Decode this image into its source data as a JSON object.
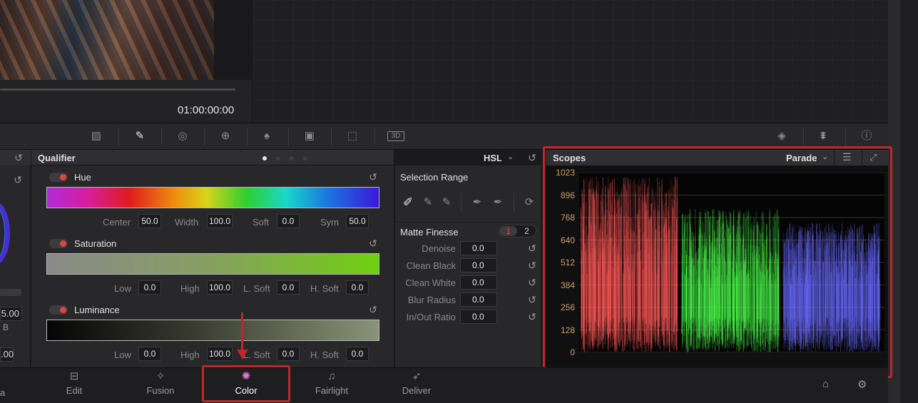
{
  "viewer": {
    "timecode": "01:00:00:00"
  },
  "left_stub": {
    "value1": "5.00",
    "channel": "B",
    "value2": ".00"
  },
  "qualifier": {
    "title": "Qualifier",
    "mode": "HSL",
    "hue": {
      "label": "Hue",
      "fields": [
        {
          "label": "Center",
          "value": "50.0"
        },
        {
          "label": "Width",
          "value": "100.0"
        },
        {
          "label": "Soft",
          "value": "0.0"
        },
        {
          "label": "Sym",
          "value": "50.0"
        }
      ]
    },
    "saturation": {
      "label": "Saturation",
      "fields": [
        {
          "label": "Low",
          "value": "0.0"
        },
        {
          "label": "High",
          "value": "100.0"
        },
        {
          "label": "L. Soft",
          "value": "0.0"
        },
        {
          "label": "H. Soft",
          "value": "0.0"
        }
      ]
    },
    "luminance": {
      "label": "Luminance",
      "fields": [
        {
          "label": "Low",
          "value": "0.0"
        },
        {
          "label": "High",
          "value": "100.0"
        },
        {
          "label": "L. Soft",
          "value": "0.0"
        },
        {
          "label": "H. Soft",
          "value": "0.0"
        }
      ]
    }
  },
  "selection_range": {
    "title": "Selection Range"
  },
  "matte_finesse": {
    "title": "Matte Finesse",
    "tabs": [
      "1",
      "2"
    ],
    "rows": [
      {
        "label": "Denoise",
        "value": "0.0"
      },
      {
        "label": "Clean Black",
        "value": "0.0"
      },
      {
        "label": "Clean White",
        "value": "0.0"
      },
      {
        "label": "Blur Radius",
        "value": "0.0"
      },
      {
        "label": "In/Out Ratio",
        "value": "0.0"
      }
    ]
  },
  "scopes": {
    "title": "Scopes",
    "mode": "Parade",
    "y_ticks": [
      "1023",
      "896",
      "768",
      "640",
      "512",
      "384",
      "256",
      "128",
      "0"
    ],
    "channels": [
      {
        "name": "red",
        "color": "#ff5a5a"
      },
      {
        "name": "green",
        "color": "#4cff4c"
      },
      {
        "name": "blue",
        "color": "#6a6aff"
      }
    ]
  },
  "pages": {
    "partial": "a",
    "edit": "Edit",
    "fusion": "Fusion",
    "color": "Color",
    "fairlight": "Fairlight",
    "deliver": "Deliver"
  },
  "accent_color": "#c0262a"
}
